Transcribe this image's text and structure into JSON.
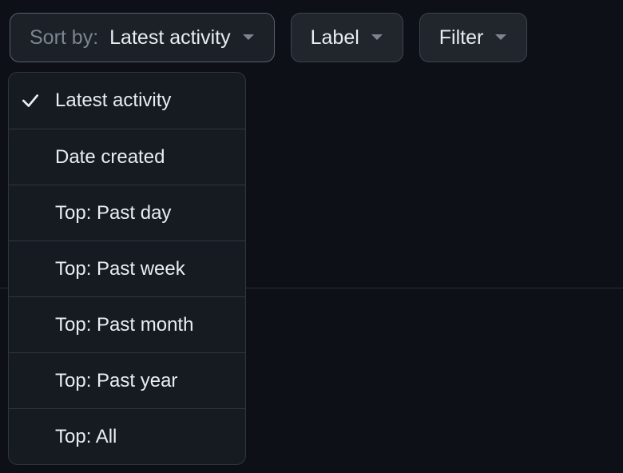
{
  "toolbar": {
    "sort": {
      "prefix": "Sort by:",
      "value": "Latest activity"
    },
    "label_button": "Label",
    "filter_button": "Filter"
  },
  "sort_menu": {
    "options": [
      {
        "label": "Latest activity",
        "selected": true
      },
      {
        "label": "Date created",
        "selected": false
      },
      {
        "label": "Top: Past day",
        "selected": false
      },
      {
        "label": "Top: Past week",
        "selected": false
      },
      {
        "label": "Top: Past month",
        "selected": false
      },
      {
        "label": "Top: Past year",
        "selected": false
      },
      {
        "label": "Top: All",
        "selected": false
      }
    ]
  }
}
